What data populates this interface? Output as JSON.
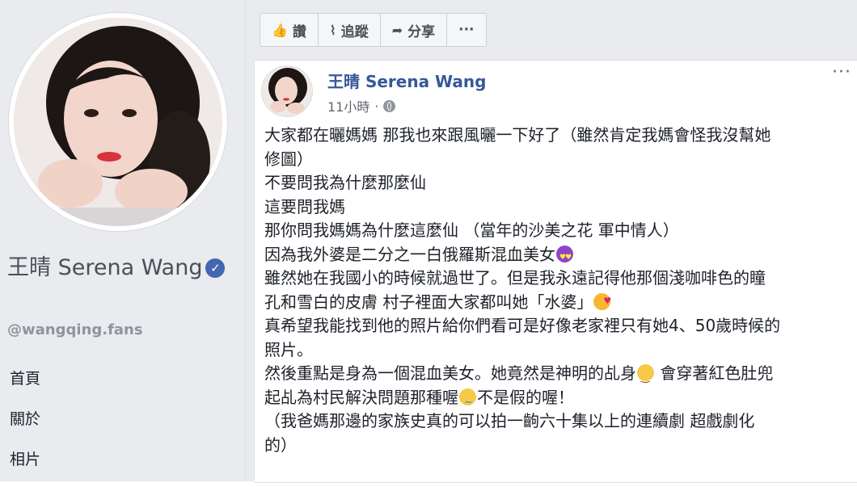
{
  "left": {
    "page_name": "王晴 Serena Wang",
    "handle": "@wangqing.fans",
    "nav": [
      {
        "label": "首頁"
      },
      {
        "label": "關於"
      },
      {
        "label": "相片"
      }
    ]
  },
  "actions": [
    {
      "label": "讚",
      "icon": "thumbs-up-icon",
      "glyph": "👍"
    },
    {
      "label": "追蹤",
      "icon": "rss-follow-icon",
      "glyph": "⌇"
    },
    {
      "label": "分享",
      "icon": "share-arrow-icon",
      "glyph": "➦"
    },
    {
      "label": "···",
      "icon": "more-options-icon",
      "glyph": ""
    }
  ],
  "post": {
    "author": "王晴 Serena Wang",
    "time": "11小時",
    "separator": "·",
    "more": "···",
    "lines": [
      {
        "text": "大家都在曬媽媽 那我也來跟風曬一下好了（雖然肯定我媽會怪我沒幫她",
        "emoji": "",
        "after": ""
      },
      {
        "text": "修圖）",
        "emoji": "",
        "after": ""
      },
      {
        "text": "不要問我為什麼那麼仙",
        "emoji": "",
        "after": ""
      },
      {
        "text": "這要問我媽",
        "emoji": "",
        "after": ""
      },
      {
        "text": "那你問我媽媽為什麼這麼仙 （當年的沙美之花 軍中情人）",
        "emoji": "",
        "after": ""
      },
      {
        "text": "因為我外婆是二分之一白俄羅斯混血美女",
        "emoji": "heart-eyes",
        "after": ""
      },
      {
        "text": "雖然她在我國小的時候就過世了。但是我永遠記得他那個淺咖啡色的瞳",
        "emoji": "",
        "after": ""
      },
      {
        "text": "孔和雪白的皮膚 村子裡面大家都叫她「水婆」",
        "emoji": "love",
        "after": ""
      },
      {
        "text": "真希望我能找到他的照片給你們看可是好像老家裡只有她4、50歲時候的",
        "emoji": "",
        "after": ""
      },
      {
        "text": "照片。",
        "emoji": "",
        "after": ""
      },
      {
        "text": "然後重點是身為一個混血美女。她竟然是神明的乩身",
        "emoji": "smile",
        "after": " 會穿著紅色肚兜"
      },
      {
        "text": "起乩為村民解決問題那種喔",
        "emoji": "tears",
        "after": "不是假的喔！"
      },
      {
        "text": "（我爸媽那邊的家族史真的可以拍一齣六十集以上的連續劇 超戲劇化",
        "emoji": "",
        "after": ""
      },
      {
        "text": "的）",
        "emoji": "",
        "after": ""
      }
    ]
  },
  "colors": {
    "link": "#365899",
    "verified": "#4267b2",
    "background": "#e9ebee"
  }
}
